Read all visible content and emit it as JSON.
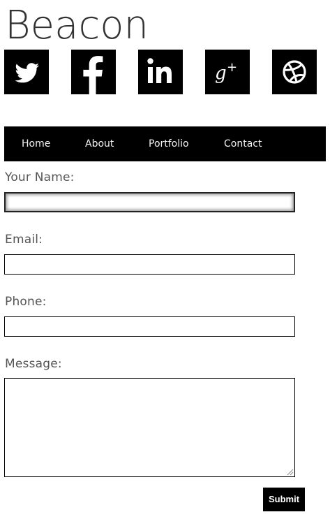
{
  "site": {
    "title": "Beacon"
  },
  "social": [
    {
      "name": "twitter",
      "icon": "twitter-bird-icon"
    },
    {
      "name": "facebook",
      "icon": "facebook-f-icon"
    },
    {
      "name": "linkedin",
      "icon": "linkedin-in-icon"
    },
    {
      "name": "google-plus",
      "icon": "google-plus-icon"
    },
    {
      "name": "dribbble",
      "icon": "dribbble-ball-icon"
    }
  ],
  "nav": {
    "items": [
      "Home",
      "About",
      "Portfolio",
      "Contact"
    ]
  },
  "form": {
    "name_label": "Your Name:",
    "name_value": "",
    "email_label": "Email:",
    "email_value": "",
    "phone_label": "Phone:",
    "phone_value": "",
    "message_label": "Message:",
    "message_value": "",
    "submit_label": "Submit"
  },
  "colors": {
    "background": "#ffffff",
    "nav_background": "#000000",
    "nav_text": "#f2f2f2",
    "icon_tile": "#000000",
    "icon_glyph": "#ffffff",
    "label_text": "#555555"
  }
}
